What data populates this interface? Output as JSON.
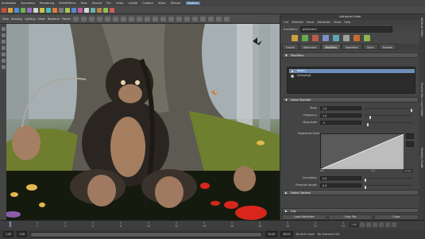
{
  "menubar": {
    "items": [
      "Animation",
      "Dynamics",
      "Rendering",
      "PaintEffects",
      "Toon",
      "Muscle",
      "Fur",
      "nHair",
      "nCloth",
      "Custom",
      "XGen",
      "ZBrush",
      "Mudbox"
    ],
    "active_index": 12
  },
  "panel": {
    "title": "Attribute Editor",
    "menus": [
      "List",
      "Selected",
      "Focus",
      "Attributes",
      "Show",
      "Help"
    ],
    "node_label": "transform:",
    "node_value": "pCylinder1",
    "tabs": [
      "Fractal",
      "Deformers",
      "Modifiers",
      "Geometry",
      "XGen",
      "Preview"
    ],
    "active_tab": 2,
    "modifiers_section": "Modifiers",
    "modifier_items": [
      {
        "label": "Noise1",
        "selected": true
      },
      {
        "label": "Clumping1",
        "selected": false
      }
    ],
    "noise_section": "Noise Modifier",
    "attrs": [
      {
        "label": "Mask",
        "value": "1.0",
        "knob": 1.0
      },
      {
        "label": "Frequency",
        "value": "1.0",
        "knob": 0.1
      },
      {
        "label": "Magnitude",
        "value": ".5",
        "knob": 0.05
      }
    ],
    "magnitude_scale_label": "Magnitude Scale",
    "graph_values": {
      "left": "0.0",
      "right": "1.0"
    },
    "graph_interp": "Linear",
    "attrs2": [
      {
        "label": "Correlation",
        "value": "0.0",
        "knob": 0.0
      },
      {
        "label": "Preserve Length",
        "value": "0.0",
        "knob": 0.0
      }
    ],
    "color_section": "Noise Options",
    "log_section": "Log",
    "footer": [
      "Load Attributes",
      "Copy Tab",
      "Close"
    ]
  },
  "vtabs": [
    "Attribute Editor",
    "Channel Box / Layer Editor",
    "Modeling Toolkit"
  ],
  "timeline": {
    "ticks": [
      "1",
      "2",
      "4",
      "6",
      "8",
      "10",
      "12",
      "14",
      "16",
      "18",
      "20",
      "22",
      "24"
    ],
    "current": "1.00"
  },
  "rangebar": {
    "start": "1.00",
    "anim_start": "1.00",
    "end": "24.00",
    "anim_end": "48.00",
    "layer": "No Anim Layer",
    "char": "No Character Set"
  },
  "colors": {
    "selection": "#6c8fb8",
    "active_menu": "#5b7fa8",
    "mushroom_red": "#d8261d",
    "mushroom_cap_yellow": "#e3b84e"
  }
}
